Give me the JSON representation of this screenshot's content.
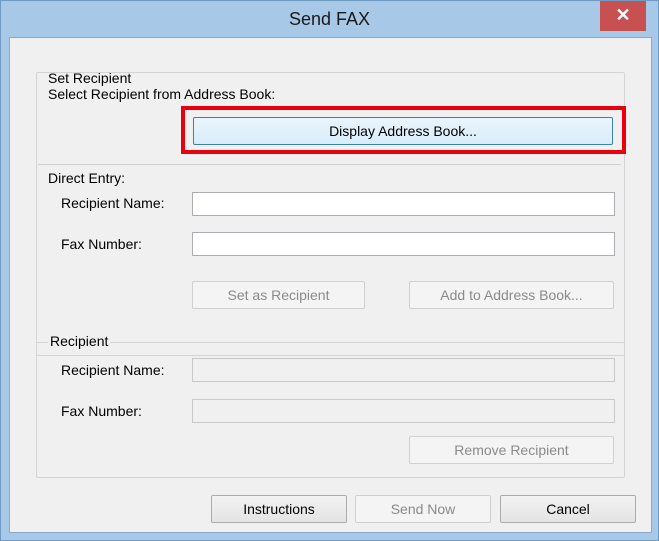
{
  "window": {
    "title": "Send FAX",
    "close_glyph": "✕"
  },
  "set_recipient": {
    "group_label": "Set Recipient",
    "instruction": "Select Recipient from Address Book:",
    "display_address_book": "Display Address Book..."
  },
  "direct_entry": {
    "label": "Direct Entry:",
    "recipient_name_label": "Recipient Name:",
    "recipient_name_value": "",
    "fax_number_label": "Fax Number:",
    "fax_number_value": "",
    "set_as_recipient": "Set as Recipient",
    "add_to_address_book": "Add to Address Book..."
  },
  "recipient": {
    "group_label": "Recipient",
    "recipient_name_label": "Recipient Name:",
    "recipient_name_value": "",
    "fax_number_label": "Fax Number:",
    "fax_number_value": "",
    "remove_recipient": "Remove Recipient"
  },
  "footer": {
    "instructions": "Instructions",
    "send_now": "Send Now",
    "cancel": "Cancel"
  },
  "colors": {
    "titlebar": "#a8c8e8",
    "close_button": "#c75050",
    "highlight": "#e8000e"
  }
}
